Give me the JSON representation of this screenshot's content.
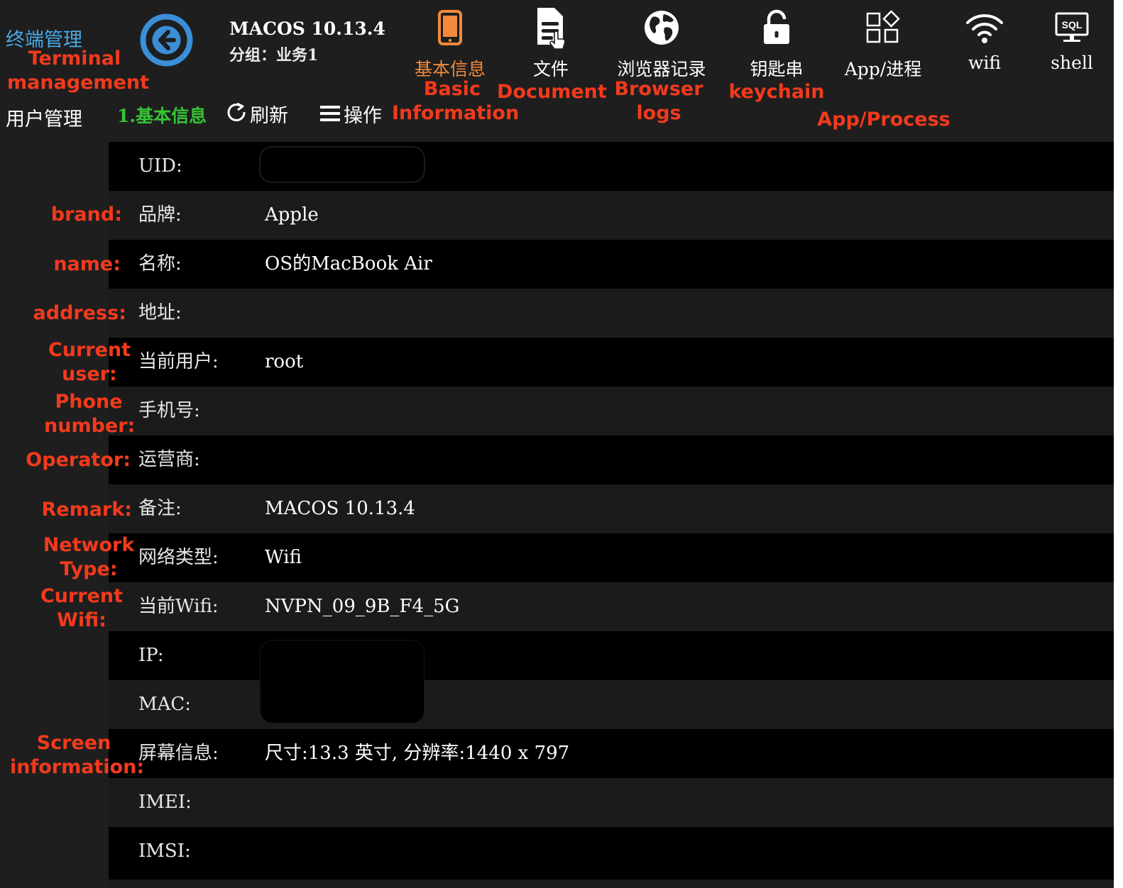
{
  "sidebar": {
    "title": "终端管理",
    "user_management": "用户管理"
  },
  "header": {
    "back_icon": "arrow-left-circle-icon",
    "device_title": "MACOS 10.13.4",
    "group_label": "分组：业务1"
  },
  "tabs": [
    {
      "label": "基本信息",
      "icon": "phone-icon",
      "active": true
    },
    {
      "label": "文件",
      "icon": "document-icon",
      "active": false
    },
    {
      "label": "浏览器记录",
      "icon": "globe-icon",
      "active": false
    },
    {
      "label": "钥匙串",
      "icon": "lock-icon",
      "active": false
    },
    {
      "label": "App/进程",
      "icon": "apps-grid-icon",
      "active": false
    },
    {
      "label": "wifi",
      "icon": "wifi-icon",
      "active": false
    },
    {
      "label": "shell",
      "icon": "sql-monitor-icon",
      "sql_badge": "SQL",
      "active": false
    }
  ],
  "toolbar": {
    "section_title": "1.基本信息",
    "refresh_label": "刷新",
    "ops_label": "操作"
  },
  "info": {
    "uid_label": "UID:",
    "uid_value": "",
    "brand_label": "品牌:",
    "brand_value": "Apple",
    "name_label": "名称:",
    "name_value": "OS的MacBook Air",
    "address_label": "地址:",
    "address_value": "",
    "current_user_label": "当前用户:",
    "current_user_value": "root",
    "phone_label": "手机号:",
    "phone_value": "",
    "operator_label": "运营商:",
    "operator_value": "",
    "remark_label": "备注:",
    "remark_value": "MACOS 10.13.4",
    "network_type_label": "网络类型:",
    "network_type_value": "Wifi",
    "current_wifi_label": "当前Wifi:",
    "current_wifi_value": "NVPN_09_9B_F4_5G",
    "ip_label": "IP:",
    "mac_label": "MAC:",
    "screen_label": "屏幕信息:",
    "screen_value": "尺寸:13.3 英寸, 分辨率:1440 x 797",
    "imei_label": "IMEI:",
    "imei_value": "",
    "imsi_label": "IMSI:",
    "imsi_value": ""
  },
  "annotations": {
    "terminal_1": "Terminal",
    "terminal_2": "management",
    "basic_1": "Basic",
    "basic_2": "Information",
    "document": "Document",
    "browser_1": "Browser",
    "browser_2": "logs",
    "keychain": "keychain",
    "app_process": "App/Process",
    "brand": "brand:",
    "name": "name:",
    "address": "address:",
    "current_user_1": "Current",
    "current_user_2": "user:",
    "phone_1": "Phone",
    "phone_2": "number:",
    "operator": "Operator:",
    "remark": "Remark:",
    "network_1": "Network",
    "network_2": "Type:",
    "wifi_1": "Current",
    "wifi_2": "Wifi:",
    "screen_1": "Screen",
    "screen_2": "information:"
  },
  "colors": {
    "sidebar_title": "#48a9e6",
    "active_tab": "#f28a3b",
    "section_title": "#35c435",
    "annotation": "#f23a1c",
    "back_button": "#3a8fd6"
  }
}
